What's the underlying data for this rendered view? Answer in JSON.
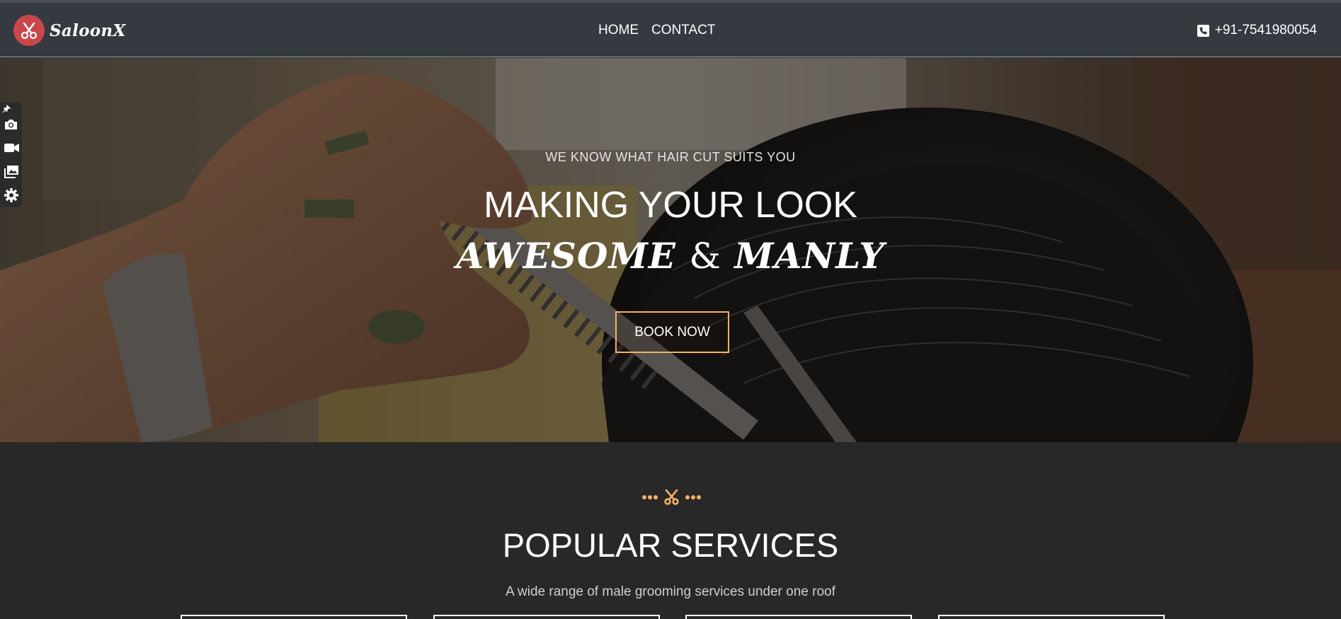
{
  "brand": {
    "name": "SaloonX",
    "logo_icon": "scissors-icon"
  },
  "nav": {
    "links": [
      "HOME",
      "CONTACT"
    ],
    "phone_icon": "phone-icon",
    "phone": "+91-7541980054"
  },
  "hero": {
    "kicker": "WE KNOW WHAT HAIR CUT SUITS YOU",
    "title_line1": "MAKING YOUR LOOK",
    "title_word1": "AWESOME",
    "title_amp": "&",
    "title_word2": "MANLY",
    "button": "BOOK NOW"
  },
  "toolbar": {
    "icons": [
      "pin-icon",
      "camera-icon",
      "video-icon",
      "gallery-icon",
      "gear-icon"
    ]
  },
  "services": {
    "divider_icon": "scissors-icon",
    "title": "POPULAR SERVICES",
    "subtitle": "A wide range of male grooming services under one roof"
  },
  "colors": {
    "accent": "#f2b266",
    "nav_bg": "#343a40",
    "page_bg": "#282828",
    "logo": "#c9474b"
  }
}
